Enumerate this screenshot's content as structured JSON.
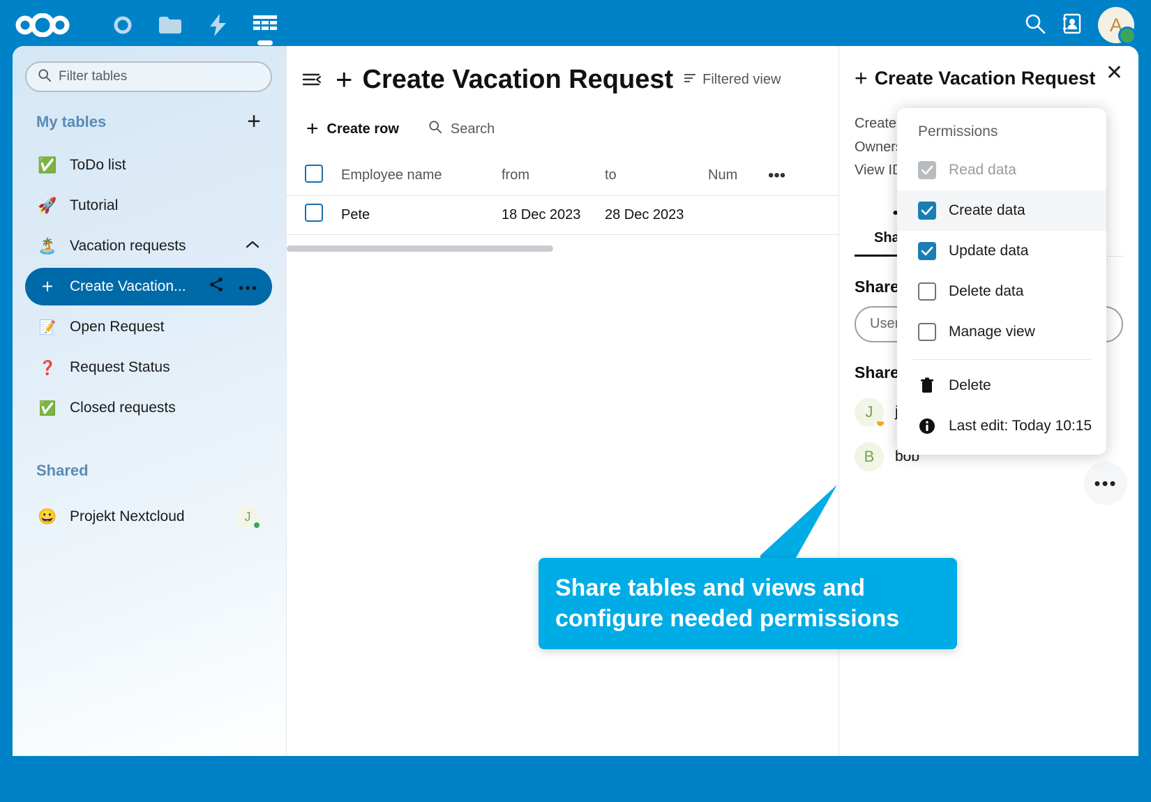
{
  "topbar": {
    "logo_name": "nextcloud-logo",
    "apps": [
      {
        "name": "dashboard-icon",
        "label": "Dashboard"
      },
      {
        "name": "files-icon",
        "label": "Files"
      },
      {
        "name": "activity-icon",
        "label": "Activity"
      },
      {
        "name": "tables-icon",
        "label": "Tables",
        "active": true
      }
    ],
    "search_label": "Search",
    "contacts_label": "Contacts",
    "avatar_initial": "A",
    "status": "online"
  },
  "sidebar": {
    "filter_placeholder": "Filter tables",
    "filter_value": "",
    "my_tables_label": "My tables",
    "add_table_label": "+",
    "tables": [
      {
        "emoji": "✅",
        "label": "ToDo list"
      },
      {
        "emoji": "🚀",
        "label": "Tutorial"
      },
      {
        "emoji": "🏝️",
        "label": "Vacation requests",
        "expanded": true
      }
    ],
    "views": [
      {
        "emoji": "+",
        "label": "Create Vacation...",
        "active": true
      },
      {
        "emoji": "📝",
        "label": "Open Request"
      },
      {
        "emoji": "❓",
        "label": "Request Status"
      },
      {
        "emoji": "✅",
        "label": "Closed requests"
      }
    ],
    "shared_label": "Shared",
    "shared_items": [
      {
        "emoji": "😀",
        "label": "Projekt Nextcloud",
        "avatar_initial": "J",
        "status": "online"
      }
    ]
  },
  "main": {
    "title": "Create Vacation Request",
    "title_plus": "+",
    "filtered_view_label": "Filtered view",
    "create_row_label": "Create row",
    "create_row_plus": "+",
    "search_label": "Search",
    "columns": [
      "Employee name",
      "from",
      "to",
      "Num"
    ],
    "rows": [
      {
        "employee_name": "Pete",
        "from": "18 Dec 2023",
        "to": "28 Dec 2023",
        "num": ""
      }
    ],
    "more_label": "•••"
  },
  "right_panel": {
    "title": "Create Vacation Request",
    "title_plus": "+",
    "close_label": "✕",
    "meta": [
      "Created at",
      "Ownership",
      "View ID"
    ],
    "tab_sharing_label": "Sharing",
    "share_with_label": "Share with ac",
    "share_input_placeholder": "User or group",
    "share_input_value": "",
    "shares_label": "Shares",
    "shares": [
      {
        "initial": "J",
        "name": "jane",
        "status": "away"
      },
      {
        "initial": "B",
        "name": "bob",
        "status": "none"
      }
    ],
    "fab_label": "•••"
  },
  "permissions_menu": {
    "heading": "Permissions",
    "items": [
      {
        "label": "Read data",
        "checked": true,
        "disabled": true,
        "hover": false
      },
      {
        "label": "Create data",
        "checked": true,
        "disabled": false,
        "hover": true
      },
      {
        "label": "Update data",
        "checked": true,
        "disabled": false,
        "hover": false
      },
      {
        "label": "Delete data",
        "checked": false,
        "disabled": false,
        "hover": false
      },
      {
        "label": "Manage view",
        "checked": false,
        "disabled": false,
        "hover": false
      }
    ],
    "actions": [
      {
        "label": "Delete",
        "icon": "trash-icon"
      },
      {
        "label": "Last edit: Today 10:15",
        "icon": "info-icon"
      }
    ]
  },
  "callout": {
    "line1": "Share tables and views and",
    "line2": "configure needed permissions",
    "color": "#00ace5"
  }
}
